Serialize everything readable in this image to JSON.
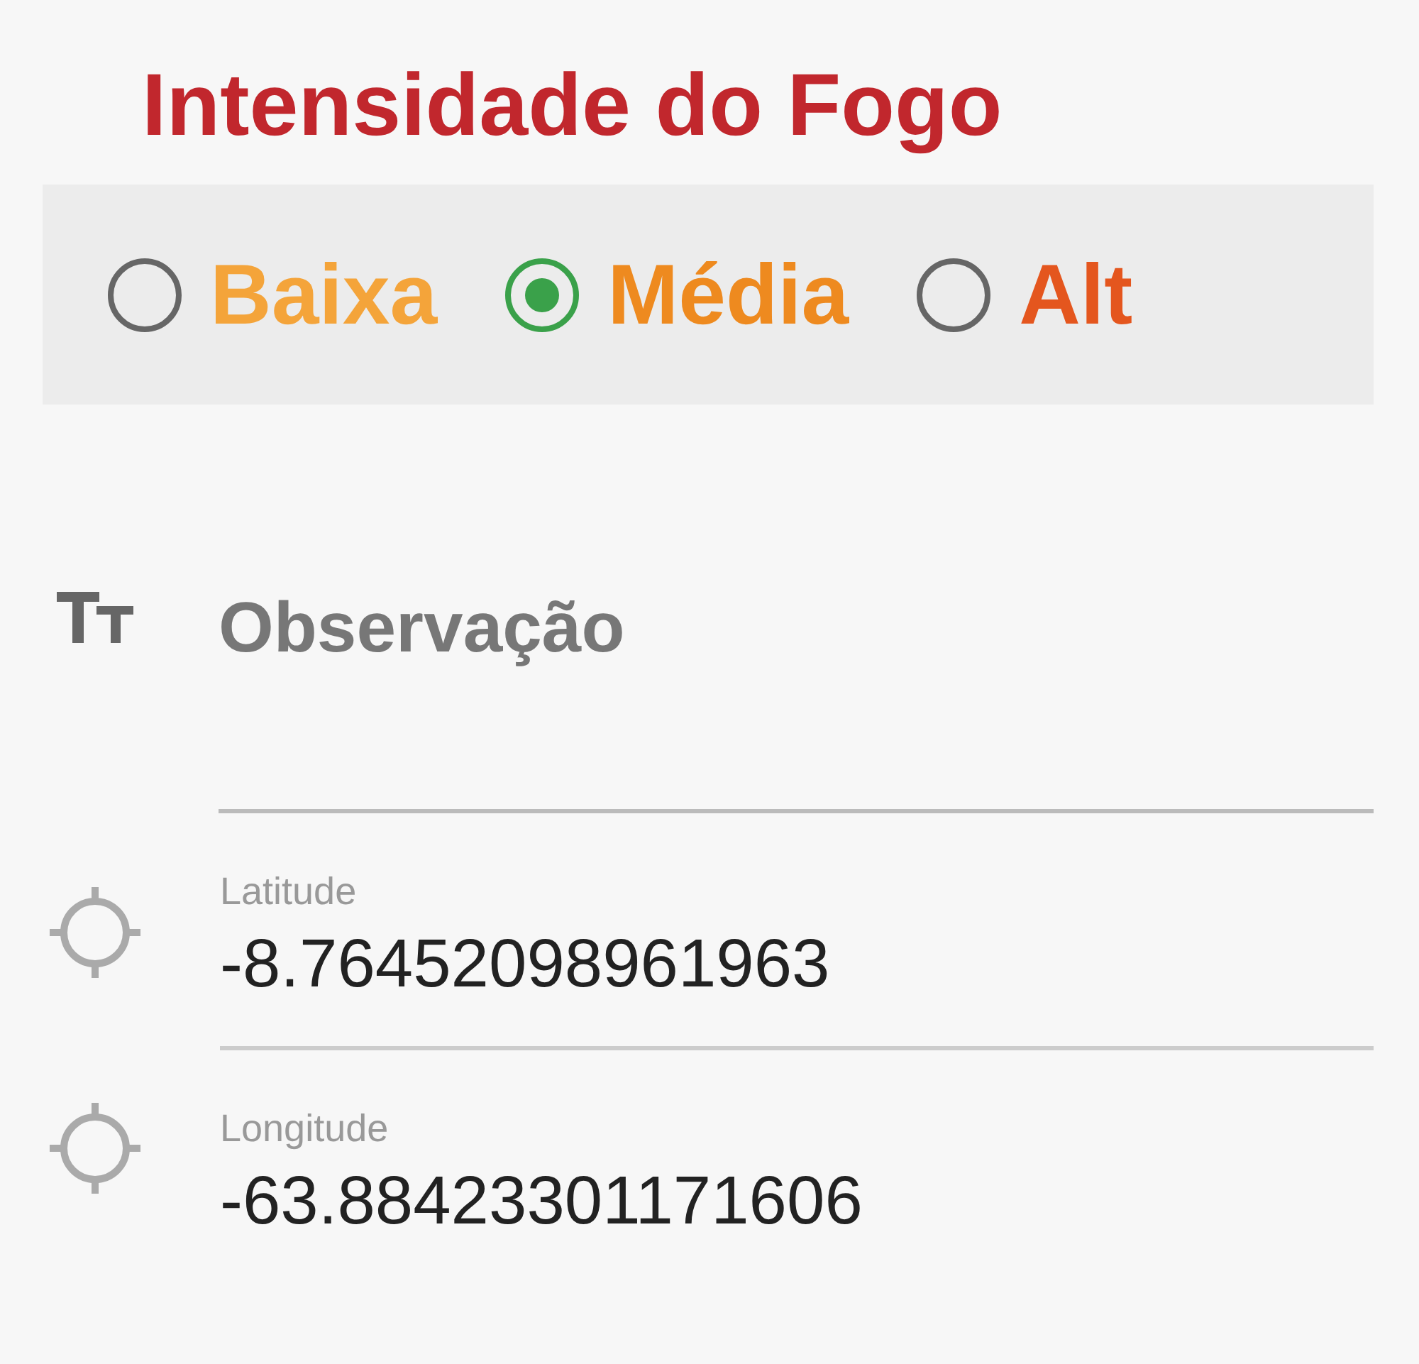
{
  "title": "Intensidade do Fogo",
  "intensity_options": [
    {
      "label": "Baixa",
      "selected": false,
      "color": "#f4a43a"
    },
    {
      "label": "Média",
      "selected": true,
      "color": "#ee8a1f"
    },
    {
      "label": "Alt",
      "selected": false,
      "color": "#e4561e"
    }
  ],
  "observation": {
    "placeholder": "Observação"
  },
  "coordinates": [
    {
      "label": "Latitude",
      "value": "-8.76452098961963"
    },
    {
      "label": "Longitude",
      "value": "-63.88423301171606"
    }
  ]
}
